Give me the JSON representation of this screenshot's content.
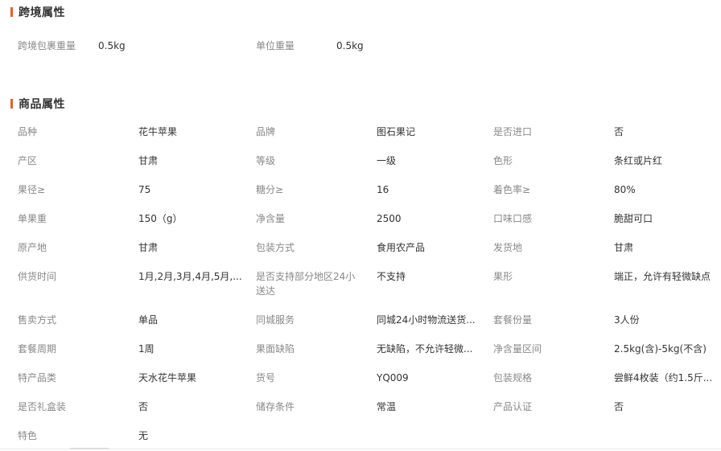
{
  "cross_border": {
    "title": "跨境属性",
    "rows": [
      [
        {
          "label": "跨境包裹重量",
          "value": "0.5kg"
        },
        {
          "label": "单位重量",
          "value": "0.5kg"
        }
      ]
    ]
  },
  "product": {
    "title": "商品属性",
    "rows": [
      [
        {
          "label": "品种",
          "value": "花牛苹果"
        },
        {
          "label": "品牌",
          "value": "图石果记"
        },
        {
          "label": "是否进口",
          "value": "否"
        }
      ],
      [
        {
          "label": "产区",
          "value": "甘肃"
        },
        {
          "label": "等级",
          "value": "一级"
        },
        {
          "label": "色形",
          "value": "条红或片红"
        }
      ],
      [
        {
          "label": "果径≥",
          "value": "75"
        },
        {
          "label": "糖分≥",
          "value": "16"
        },
        {
          "label": "着色率≥",
          "value": "80%"
        }
      ],
      [
        {
          "label": "单果重",
          "value": "150（g）"
        },
        {
          "label": "净含量",
          "value": "2500"
        },
        {
          "label": "口味口感",
          "value": "脆甜可口"
        }
      ],
      [
        {
          "label": "原产地",
          "value": "甘肃"
        },
        {
          "label": "包装方式",
          "value": "食用农产品"
        },
        {
          "label": "发货地",
          "value": "甘肃"
        }
      ],
      [
        {
          "label": "供货时间",
          "value": "1月,2月,3月,4月,5月,..."
        },
        {
          "label": "是否支持部分地区24小送达",
          "value": "不支持"
        },
        {
          "label": "果形",
          "value": "端正，允许有轻微缺点"
        }
      ],
      [
        {
          "label": "售卖方式",
          "value": "单品"
        },
        {
          "label": "同城服务",
          "value": "同城24小时物流送货..."
        },
        {
          "label": "套餐份量",
          "value": "3人份"
        }
      ],
      [
        {
          "label": "套餐周期",
          "value": "1周"
        },
        {
          "label": "果面缺陷",
          "value": "无缺陷，不允许轻微..."
        },
        {
          "label": "净含量区间",
          "value": "2.5kg(含)-5kg(不含)"
        }
      ],
      [
        {
          "label": "特产品类",
          "value": "天水花牛苹果"
        },
        {
          "label": "货号",
          "value": "YQ009"
        },
        {
          "label": "包装规格",
          "value": "尝鲜4枚装（约1.5斤..."
        }
      ],
      [
        {
          "label": "是否礼盒装",
          "value": "否"
        },
        {
          "label": "储存条件",
          "value": "常温"
        },
        {
          "label": "产品认证",
          "value": "否"
        }
      ],
      [
        {
          "label": "特色",
          "value": "无"
        }
      ]
    ]
  }
}
